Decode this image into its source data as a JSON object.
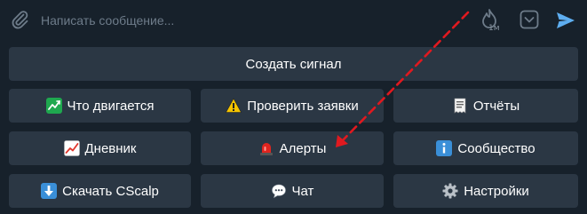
{
  "composer": {
    "placeholder": "Написать сообщение...",
    "timer_label": "1м"
  },
  "keyboard": {
    "create_signal": "Создать сигнал",
    "whats_moving": "Что двигается",
    "check_orders": "Проверить заявки",
    "reports": "Отчёты",
    "diary": "Дневник",
    "alerts": "Алерты",
    "community": "Сообщество",
    "download": "Скачать CScalp",
    "chat": "Чат",
    "settings": "Настройки"
  },
  "colors": {
    "background": "#17212b",
    "button": "#2b3744",
    "accent": "#5eaef0",
    "arrow": "#e0191f"
  }
}
